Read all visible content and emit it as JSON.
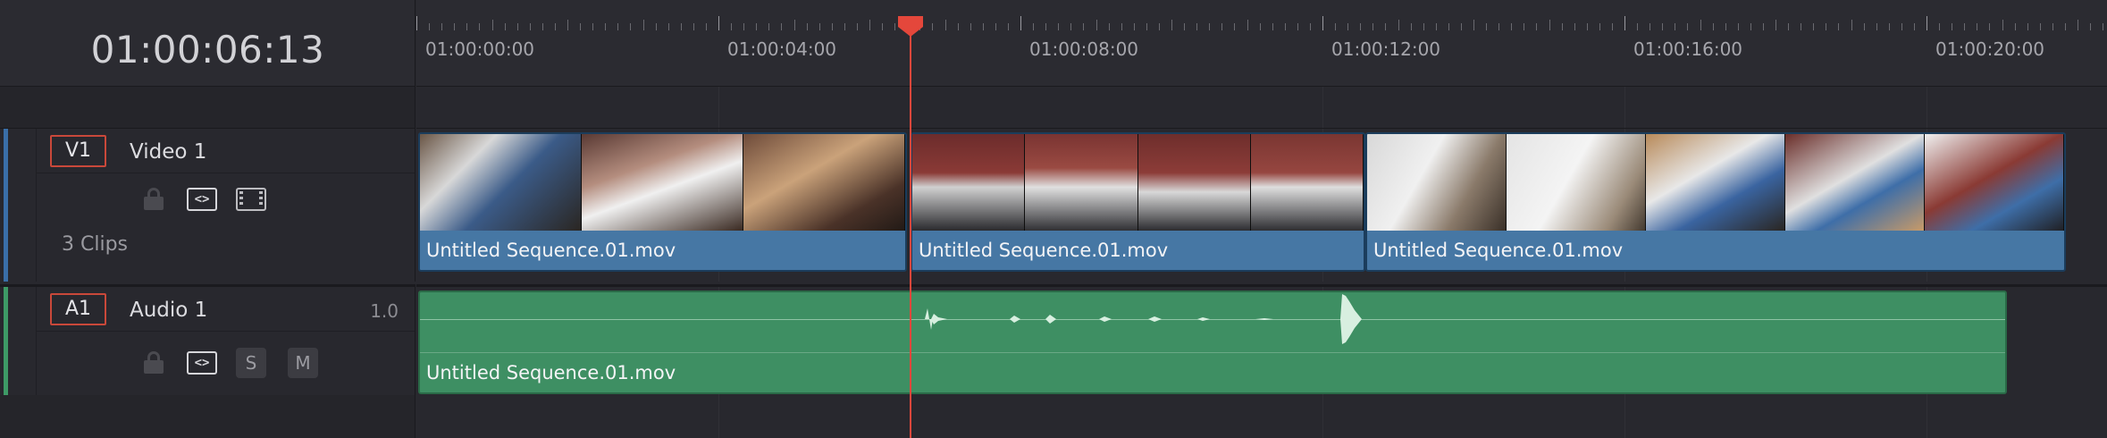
{
  "header": {
    "timecode": "01:00:06:13",
    "ruler_labels": [
      "01:00:00:00",
      "01:00:04:00",
      "01:00:08:00",
      "01:00:12:00",
      "01:00:16:00",
      "01:00:20:00"
    ]
  },
  "tracks": {
    "video": {
      "id": "V1",
      "name": "Video 1",
      "clip_count_label": "3 Clips",
      "color": "#3a6fa8",
      "clips": [
        {
          "label": "Untitled Sequence.01.mov"
        },
        {
          "label": "Untitled Sequence.01.mov"
        },
        {
          "label": "Untitled Sequence.01.mov"
        }
      ]
    },
    "audio": {
      "id": "A1",
      "name": "Audio 1",
      "level": "1.0",
      "solo_label": "S",
      "mute_label": "M",
      "color": "#3e9a66",
      "clips": [
        {
          "label": "Untitled Sequence.01.mov"
        }
      ]
    }
  },
  "icons": {
    "lock": "lock-icon",
    "auto_select": "auto-select-icon",
    "film": "film-icon"
  },
  "colors": {
    "playhead": "#e4473b",
    "track_id_border": "#c9483a",
    "video_clip": "#4677a4",
    "audio_clip": "#3e8f63"
  }
}
